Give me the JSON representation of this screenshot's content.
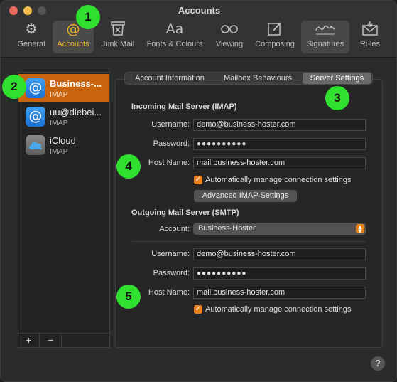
{
  "window": {
    "title": "Accounts",
    "traffic_lights": [
      "close",
      "minimize",
      "zoom"
    ]
  },
  "toolbar": {
    "items": [
      {
        "label": "General",
        "icon": "gear-icon",
        "glyph": "⚙"
      },
      {
        "label": "Accounts",
        "icon": "at-icon",
        "glyph": "@"
      },
      {
        "label": "Junk Mail",
        "icon": "junk-icon",
        "glyph": "🗑"
      },
      {
        "label": "Fonts & Colours",
        "icon": "fonts-icon",
        "glyph": "Aa"
      },
      {
        "label": "Viewing",
        "icon": "glasses-icon",
        "glyph": "oo"
      },
      {
        "label": "Composing",
        "icon": "compose-icon",
        "glyph": "✎"
      },
      {
        "label": "Signatures",
        "icon": "signature-icon",
        "glyph": "✍"
      },
      {
        "label": "Rules",
        "icon": "rules-icon",
        "glyph": "✉"
      }
    ],
    "active": "Accounts"
  },
  "sidebar": {
    "accounts": [
      {
        "name": "Business-...",
        "type": "IMAP",
        "icon": "at-icon",
        "selected": true
      },
      {
        "name": "uu@diebei...",
        "type": "IMAP",
        "icon": "at-icon",
        "selected": false
      },
      {
        "name": "iCloud",
        "type": "IMAP",
        "icon": "cloud-icon",
        "selected": false
      }
    ],
    "add_label": "+",
    "remove_label": "−"
  },
  "tabs": {
    "items": [
      "Account Information",
      "Mailbox Behaviours",
      "Server Settings"
    ],
    "selected": "Server Settings"
  },
  "incoming": {
    "title": "Incoming Mail Server (IMAP)",
    "username_label": "Username:",
    "username": "demo@business-hoster.com",
    "password_label": "Password:",
    "password": "●●●●●●●●●●",
    "host_label": "Host Name:",
    "host": "mail.business-hoster.com",
    "auto_manage": "Automatically manage connection settings",
    "auto_checked": true,
    "advanced_button": "Advanced IMAP Settings"
  },
  "outgoing": {
    "title": "Outgoing Mail Server (SMTP)",
    "account_label": "Account:",
    "account": "Business-Hoster",
    "username_label": "Username:",
    "username": "demo@business-hoster.com",
    "password_label": "Password:",
    "password": "●●●●●●●●●●",
    "host_label": "Host Name:",
    "host": "mail.business-hoster.com",
    "auto_manage": "Automatically manage connection settings",
    "auto_checked": true
  },
  "help_label": "?",
  "markers": [
    "1",
    "2",
    "3",
    "4",
    "5"
  ],
  "colors": {
    "accent": "#e8811a",
    "selection": "#c8640d",
    "active_tool": "#f0b429",
    "marker": "#2fe02f"
  }
}
